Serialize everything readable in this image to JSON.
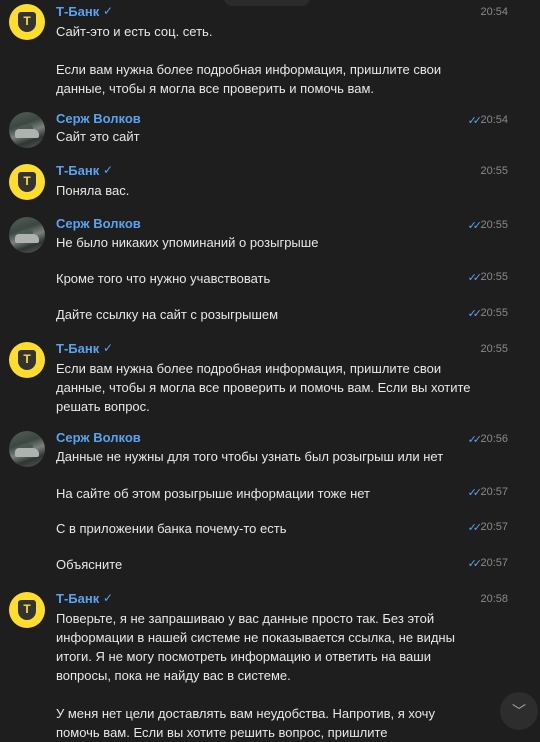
{
  "messages": [
    {
      "sender": "Т-Банк",
      "time": "20:54",
      "text": "Сайт-это и есть соц. сеть.\n\nЕсли вам нужна более подробная информация, пришлите свои данные, чтобы я могла все проверить и помочь вам."
    },
    {
      "sender": "Серж Волков",
      "time": "20:54",
      "text": "Сайт это сайт"
    },
    {
      "sender": "Т-Банк",
      "time": "20:55",
      "text": "Поняла вас."
    },
    {
      "sender": "Серж Волков",
      "time": "20:55",
      "text": "Не было никаких упоминаний о розыгрыше"
    },
    {
      "time": "20:55",
      "text": "Кроме того что нужно учавствовать"
    },
    {
      "time": "20:55",
      "text": "Дайте ссылку на сайт с розыгрышем"
    },
    {
      "sender": "Т-Банк",
      "time": "20:55",
      "text": "Если вам нужна более подробная информация, пришлите свои данные, чтобы я могла все проверить и помочь вам. Если вы хотите решать вопрос."
    },
    {
      "sender": "Серж Волков",
      "time": "20:56",
      "text": "Данные не нужны для того чтобы узнать был розыгрыш или нет"
    },
    {
      "time": "20:57",
      "text": "На сайте об этом розыгрыше информации тоже нет"
    },
    {
      "time": "20:57",
      "text": "С в приложении банка почему-то есть"
    },
    {
      "time": "20:57",
      "text": "Объясните"
    },
    {
      "sender": "Т-Банк",
      "time": "20:58",
      "text": "Поверьте, я не запрашиваю у вас данные просто так. Без этой информации в нашей системе не показывается ссылка, не видны итоги. Я не могу посмотреть информацию и ответить на ваши вопросы, пока не найду вас в системе.\n\nУ меня нет цели доставлять вам неудобства. Напротив, я хочу помочь вам. Если вы хотите решить вопрос, пришлите"
    }
  ],
  "icons": {
    "verified": "✓",
    "read_ticks": "✓✓",
    "scroll_down": "﹀",
    "tbank_letter": "T"
  }
}
